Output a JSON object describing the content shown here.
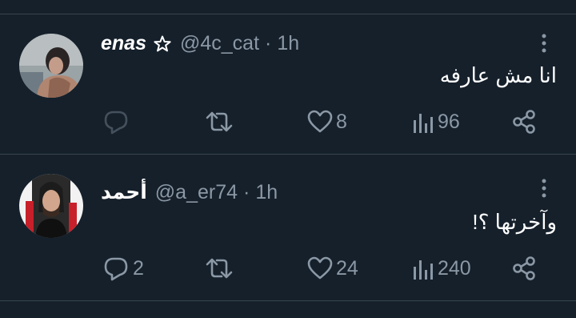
{
  "posts": [
    {
      "display_name": "enas",
      "badge_icon": "star-outline-icon",
      "handle": "@4c_cat",
      "separator": "·",
      "time": "1h",
      "text": "انا مش عارفه",
      "replies": "",
      "retweets": "",
      "likes": "8",
      "views": "96"
    },
    {
      "display_name": "أحمد",
      "handle": "@a_er74",
      "separator": "·",
      "time": "1h",
      "text": "وآخرتها ؟!",
      "replies": "2",
      "retweets": "",
      "likes": "24",
      "views": "240"
    }
  ],
  "colors": {
    "background": "#15202b",
    "divider": "#38444d",
    "primary_text": "#ffffff",
    "secondary_text": "#8b98a5"
  }
}
